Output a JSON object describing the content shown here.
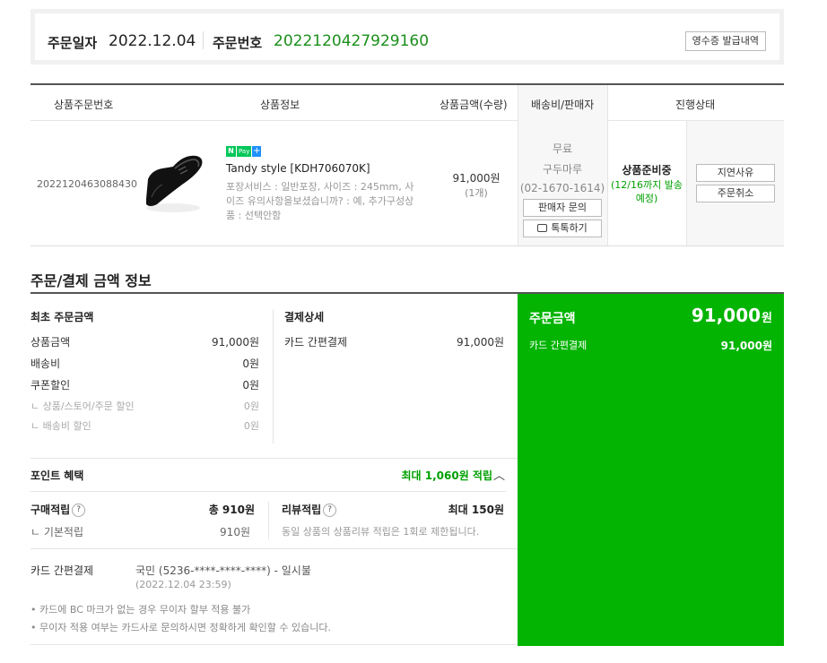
{
  "order": {
    "date_label": "주문일자",
    "date_value": "2022.12.04",
    "number_label": "주문번호",
    "number_value": "2022120427929160",
    "receipt_button": "영수증 발급내역"
  },
  "table_headers": {
    "product_order_no": "상품주문번호",
    "product_info": "상품정보",
    "price_qty": "상품금액(수량)",
    "shipping_seller": "배송비/판매자",
    "status": "진행상태"
  },
  "product": {
    "order_no": "2022120463088430",
    "image_icon": "dress-shoe-image",
    "npay_badge": {
      "n": "N",
      "pay": "Pay",
      "plus": "+"
    },
    "name": "Tandy style [KDH706070K]",
    "options": "포장서비스 : 일반포장, 사이즈 : 245mm, 사이즈 유의사항을보셨습니까? : 예, 추가구성상품 : 선택안함",
    "price": "91,000원",
    "quantity": "(1개)",
    "shipping_fee": "무료",
    "seller": "구두마루",
    "seller_phone": "(02-1670-1614)",
    "seller_inquiry_button": "판매자 문의",
    "talk_button": "톡톡하기",
    "status_main": "상품준비중",
    "status_sub": "(12/16까지 발송예정)",
    "delay_reason_button": "지연사유",
    "cancel_button": "주문취소"
  },
  "payment_section_title": "주문/결제 금액 정보",
  "initial_amount": {
    "title": "최초 주문금액",
    "rows": [
      {
        "label": "상품금액",
        "value": "91,000원"
      },
      {
        "label": "배송비",
        "value": "0원"
      },
      {
        "label": "쿠폰할인",
        "value": "0원"
      },
      {
        "label": "ㄴ 상품/스토어/주문 할인",
        "value": "0원"
      },
      {
        "label": "ㄴ 배송비 할인",
        "value": "0원"
      }
    ]
  },
  "payment_detail": {
    "title": "결제상세",
    "method": "카드 간편결제",
    "amount": "91,000원"
  },
  "points": {
    "title": "포인트 혜택",
    "max_label": "최대 1,060원 적립",
    "purchase_label": "구매적립",
    "purchase_total": "총 910원",
    "basic_label": "ㄴ 기본적립",
    "basic_value": "910원",
    "review_label": "리뷰적립",
    "review_max": "최대 150원",
    "review_note": "동일 상품의 상품리뷰 적립은 1회로 제한됩니다."
  },
  "card": {
    "label": "카드 간편결제",
    "info": "국민 (5236-****-****-****) - 일시불",
    "date": "(2022.12.04 23:59)",
    "notes": [
      "카드에 BC 마크가 없는 경우 무이자 할부 적용 불가",
      "무이자 적용 여부는 카드사로 문의하시면 정확하게 확인할 수 있습니다."
    ]
  },
  "total": {
    "label": "주문금액",
    "amount": "91,000",
    "unit": "원",
    "method_label": "카드 간편결제",
    "method_amount": "91,000원"
  },
  "colors": {
    "accent_green": "#03b403",
    "status_green": "#00a000",
    "order_no_green": "#1b8f1b"
  }
}
